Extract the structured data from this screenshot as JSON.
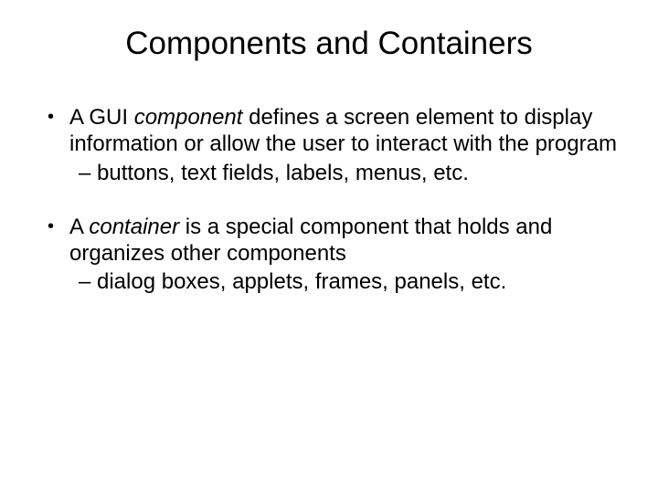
{
  "title": "Components and Containers",
  "bullets": [
    {
      "pre": "A GUI ",
      "em": "component",
      "post": " defines a screen element to display information or allow the user to interact with the program",
      "sub": "buttons, text fields, labels, menus, etc."
    },
    {
      "pre": "A ",
      "em": "container",
      "post": " is a special component that holds and organizes other components",
      "sub": "dialog boxes, applets, frames, panels, etc."
    }
  ]
}
